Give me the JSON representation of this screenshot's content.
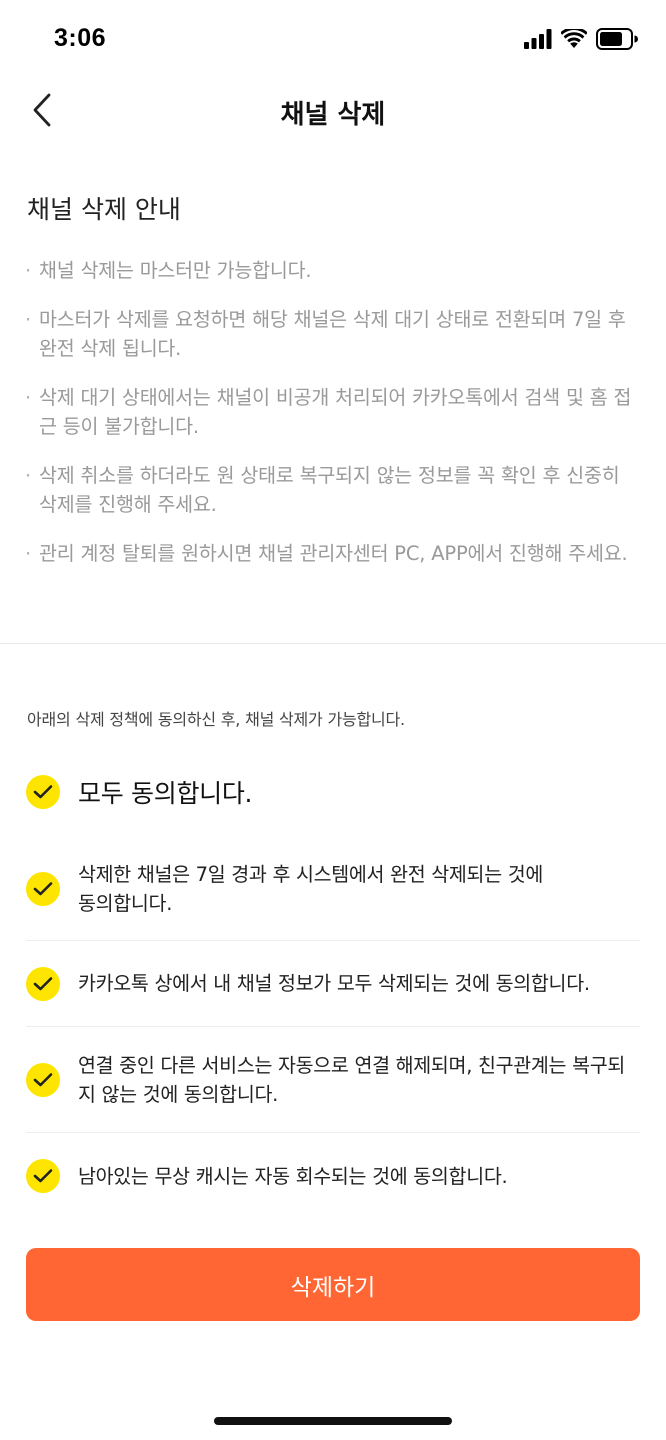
{
  "status_bar": {
    "time": "3:06",
    "icons": [
      "signal-icon",
      "wifi-icon",
      "battery-icon"
    ]
  },
  "nav": {
    "back_icon": "chevron-left-icon",
    "title": "채널 삭제"
  },
  "guide": {
    "title": "채널 삭제 안내",
    "items": [
      "채널 삭제는 마스터만 가능합니다.",
      "마스터가 삭제를 요청하면 해당 채널은 삭제 대기 상태로 전환되며 7일 후 완전 삭제 됩니다.",
      "삭제 대기 상태에서는 채널이 비공개 처리되어 카카오톡에서 검색 및 홈 접근 등이 불가합니다.",
      "삭제 취소를 하더라도 원 상태로 복구되지 않는 정보를 꼭 확인 후 신중히 삭제를 진행해 주세요.",
      "관리 계정 탈퇴를 원하시면 채널 관리자센터 PC, APP에서 진행해 주세요."
    ]
  },
  "agreement": {
    "intro": "아래의 삭제 정책에 동의하신 후, 채널 삭제가 가능합니다.",
    "all_label": "모두 동의합니다.",
    "items": [
      "삭제한 채널은 7일 경과 후 시스템에서 완전 삭제되는 것에 동의합니다.",
      "카카오톡 상에서 내 채널 정보가 모두 삭제되는 것에 동의합니다.",
      "연결 중인 다른 서비스는 자동으로 연결 해제되며, 친구관계는 복구되지 않는 것에 동의합니다.",
      "남아있는 무상 캐시는 자동 회수되는 것에 동의합니다."
    ],
    "checked": true
  },
  "actions": {
    "delete_label": "삭제하기"
  },
  "colors": {
    "check_yellow": "#FEE500",
    "delete_button": "#FF6633",
    "guide_text": "#9a9a9a"
  }
}
